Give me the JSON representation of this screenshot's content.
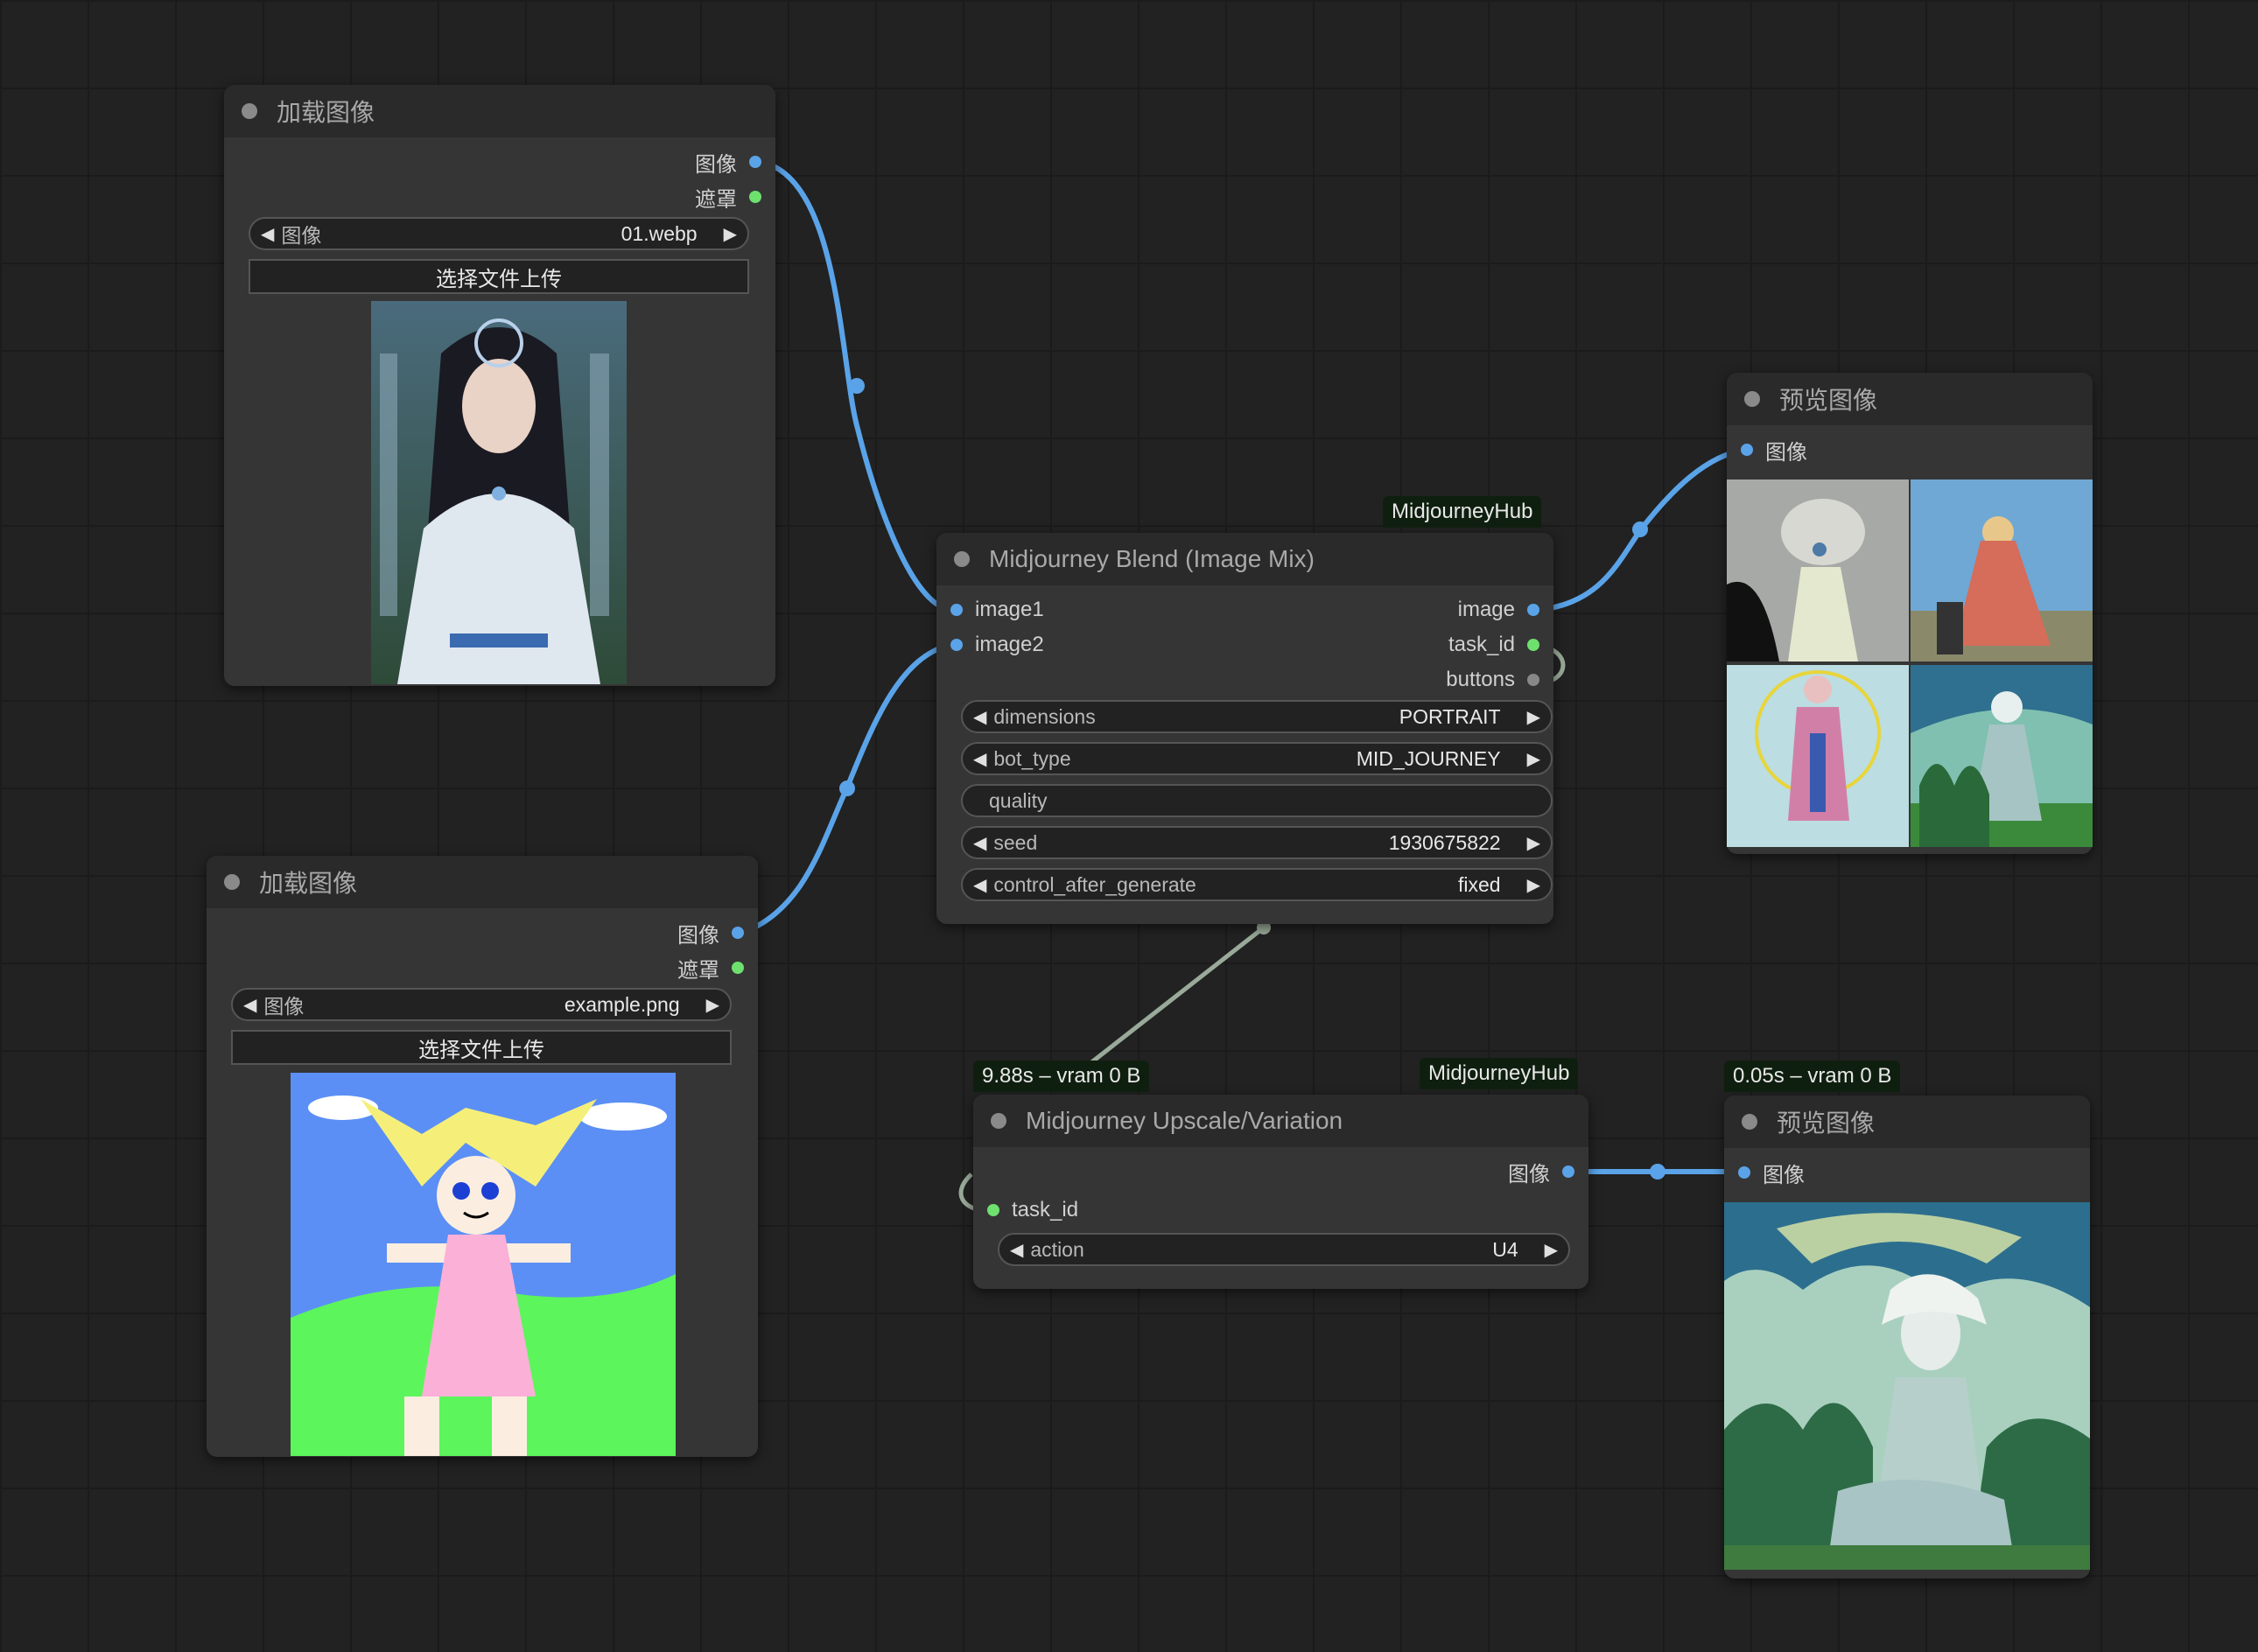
{
  "load_node_1": {
    "title": "加载图像",
    "outputs": [
      "图像",
      "遮罩"
    ],
    "image_widget": {
      "label": "图像",
      "value": "01.webp"
    },
    "upload_label": "选择文件上传"
  },
  "load_node_2": {
    "title": "加载图像",
    "outputs": [
      "图像",
      "遮罩"
    ],
    "image_widget": {
      "label": "图像",
      "value": "example.png"
    },
    "upload_label": "选择文件上传"
  },
  "blend_node": {
    "badge": "MidjourneyHub",
    "title": "Midjourney Blend (Image Mix)",
    "inputs": [
      "image1",
      "image2"
    ],
    "outputs": [
      "image",
      "task_id",
      "buttons"
    ],
    "widgets": [
      {
        "label": "dimensions",
        "value": "PORTRAIT"
      },
      {
        "label": "bot_type",
        "value": "MID_JOURNEY"
      },
      {
        "label": "quality",
        "value": ""
      },
      {
        "label": "seed",
        "value": "1930675822"
      },
      {
        "label": "control_after_generate",
        "value": "fixed"
      }
    ]
  },
  "upscale_node": {
    "timing": "9.88s – vram 0 B",
    "badge": "MidjourneyHub",
    "title": "Midjourney Upscale/Variation",
    "input": "task_id",
    "output": "图像",
    "action_widget": {
      "label": "action",
      "value": "U4"
    }
  },
  "preview_node_1": {
    "title": "预览图像",
    "input": "图像"
  },
  "preview_node_2": {
    "timing": "0.05s – vram 0 B",
    "title": "预览图像",
    "input": "图像"
  },
  "colors": {
    "image_link": "#5aa3e8",
    "task_link": "#9aaa9a",
    "canvas": "#222222",
    "node_body": "#353535",
    "node_title": "#2a2a2a"
  }
}
